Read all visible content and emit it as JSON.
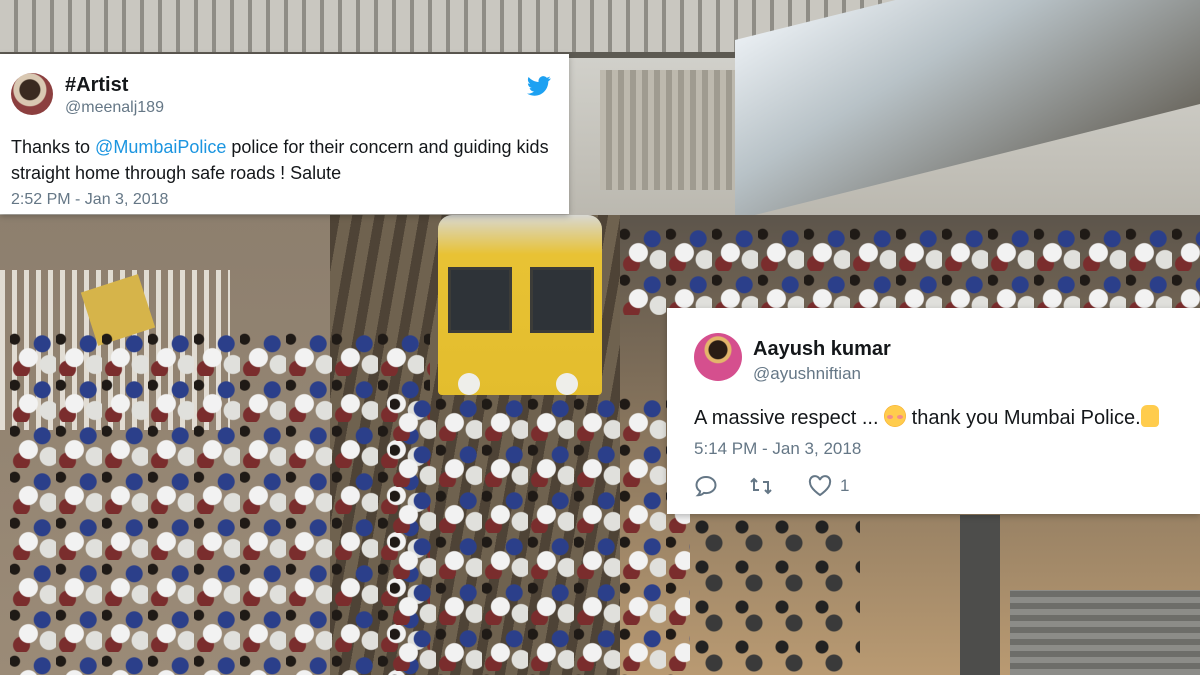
{
  "tweets": [
    {
      "display_name": "#Artist",
      "handle": "@meenalj189",
      "text_before": "Thanks to ",
      "mention": "@MumbaiPolice",
      "text_after": " police for their concern and guiding kids straight home through safe roads ! Salute",
      "timestamp": "2:52 PM - Jan 3, 2018",
      "icon": "twitter-bird-icon",
      "brand_color": "#1da1f2"
    },
    {
      "display_name": "Aayush kumar",
      "handle": "@ayushniftian",
      "text_before": "A massive respect ... ",
      "text_after": " thank you Mumbai Police.",
      "timestamp": "5:14 PM - Jan 3, 2018",
      "actions": {
        "reply_icon": "reply-icon",
        "retweet_icon": "retweet-icon",
        "like_icon": "heart-icon",
        "like_count": "1"
      }
    }
  ],
  "colors": {
    "mention": "#1b95e0",
    "muted": "#657786",
    "card_bg": "#ffffff"
  }
}
